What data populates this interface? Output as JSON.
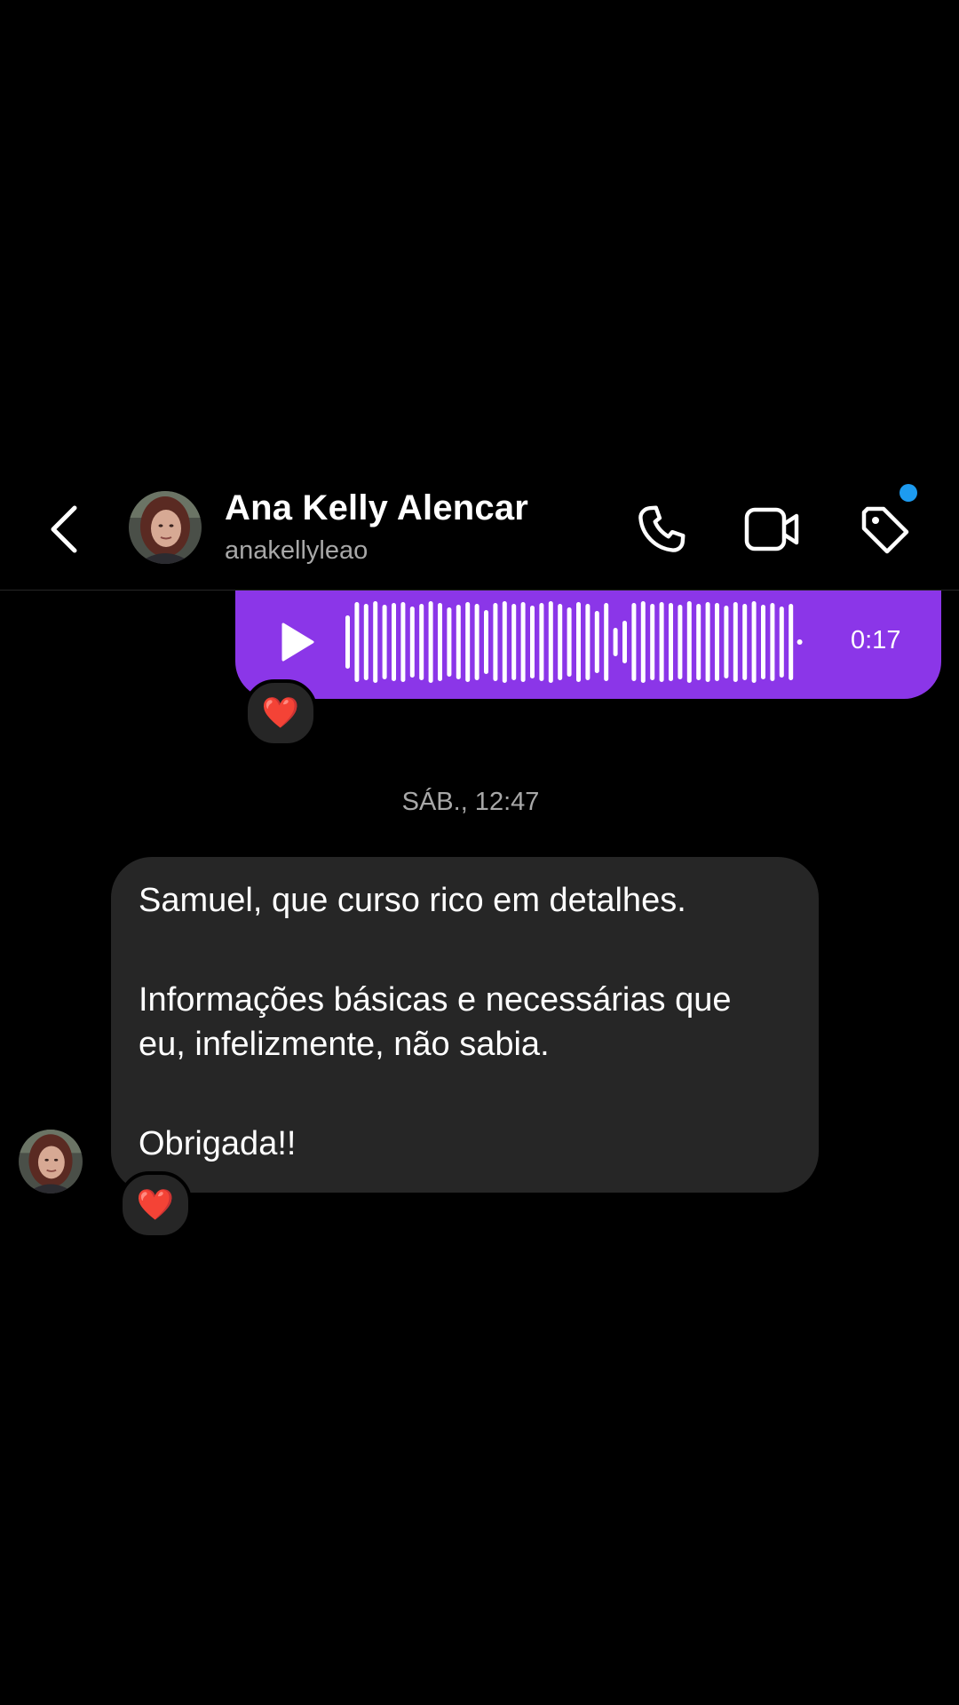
{
  "header": {
    "contact_name": "Ana Kelly Alencar",
    "contact_handle": "anakellyleao",
    "icons": [
      "chevron-left-icon",
      "avatar",
      "phone-icon",
      "video-camera-icon",
      "tag-icon"
    ],
    "notification_dot_color": "#1d9bf0"
  },
  "voice_message": {
    "duration": "0:17",
    "bubble_color": "#8b36e8",
    "reaction": "❤️"
  },
  "timestamp": "SÁB., 12:47",
  "received_message": {
    "lines": [
      "Samuel, que curso rico em detalhes.",
      "Informações básicas e necessárias que",
      "eu, infelizmente, não sabia.",
      "Obrigada!!"
    ],
    "bubble_color": "#262626",
    "reaction": "❤️"
  }
}
